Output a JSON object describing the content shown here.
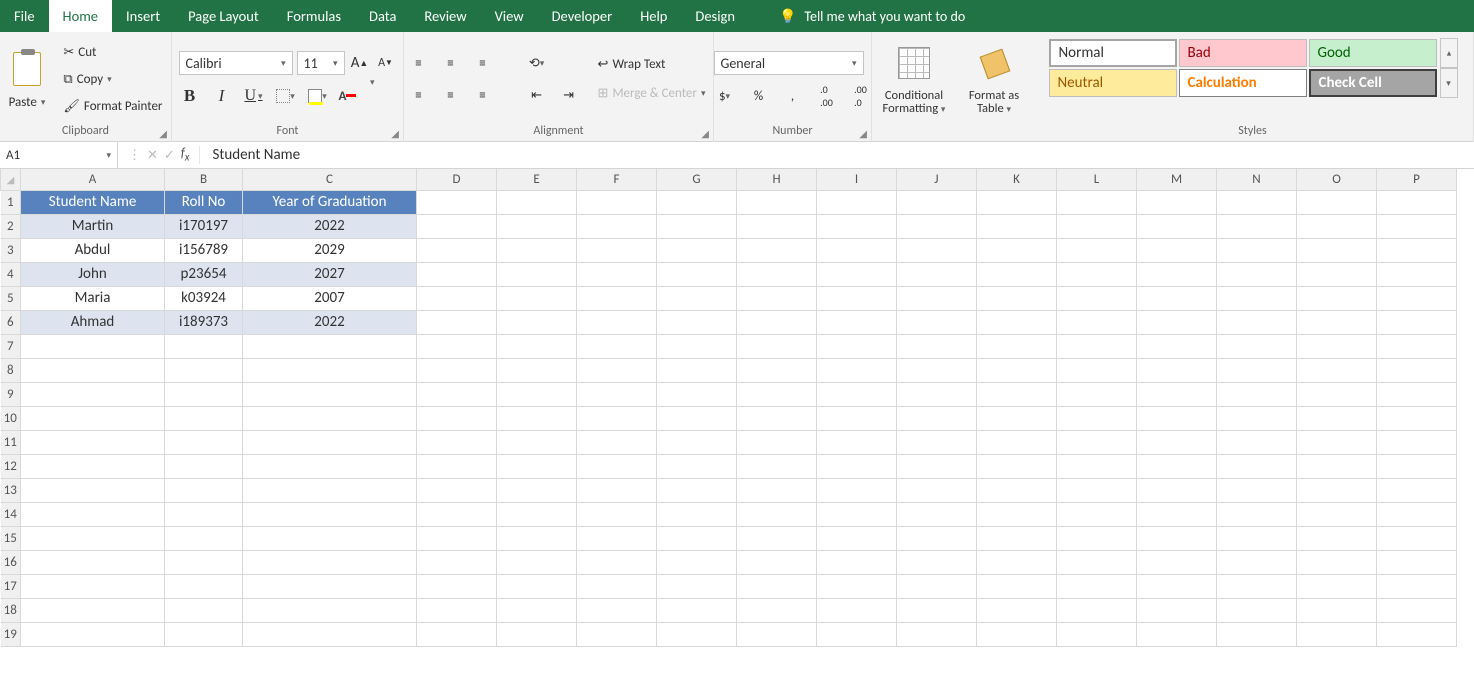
{
  "tabs": [
    "File",
    "Home",
    "Insert",
    "Page Layout",
    "Formulas",
    "Data",
    "Review",
    "View",
    "Developer",
    "Help",
    "Design"
  ],
  "active_tab": "Home",
  "tellme": "Tell me what you want to do",
  "clipboard": {
    "paste": "Paste",
    "cut": "Cut",
    "copy": "Copy",
    "format_painter": "Format Painter",
    "label": "Clipboard"
  },
  "font": {
    "name": "Calibri",
    "size": "11",
    "label": "Font"
  },
  "alignment": {
    "wrap": "Wrap Text",
    "merge": "Merge & Center",
    "label": "Alignment"
  },
  "number": {
    "format": "General",
    "label": "Number"
  },
  "cond_fmt": "Conditional Formatting",
  "fmt_table": "Format as Table",
  "styles": {
    "normal": "Normal",
    "bad": "Bad",
    "good": "Good",
    "neutral": "Neutral",
    "calculation": "Calculation",
    "check_cell": "Check Cell",
    "label": "Styles"
  },
  "name_box": "A1",
  "formula_value": "Student Name",
  "columns": [
    "A",
    "B",
    "C",
    "D",
    "E",
    "F",
    "G",
    "H",
    "I",
    "J",
    "K",
    "L",
    "M",
    "N",
    "O",
    "P"
  ],
  "col_widths_key": [
    "A",
    "B",
    "C"
  ],
  "rows": 19,
  "table": {
    "headers": [
      "Student Name",
      "Roll No",
      "Year of Graduation"
    ],
    "data": [
      [
        "Martin",
        "i170197",
        "2022"
      ],
      [
        "Abdul",
        "i156789",
        "2029"
      ],
      [
        "John",
        "p23654",
        "2027"
      ],
      [
        "Maria",
        "k03924",
        "2007"
      ],
      [
        "Ahmad",
        "i189373",
        "2022"
      ]
    ]
  }
}
